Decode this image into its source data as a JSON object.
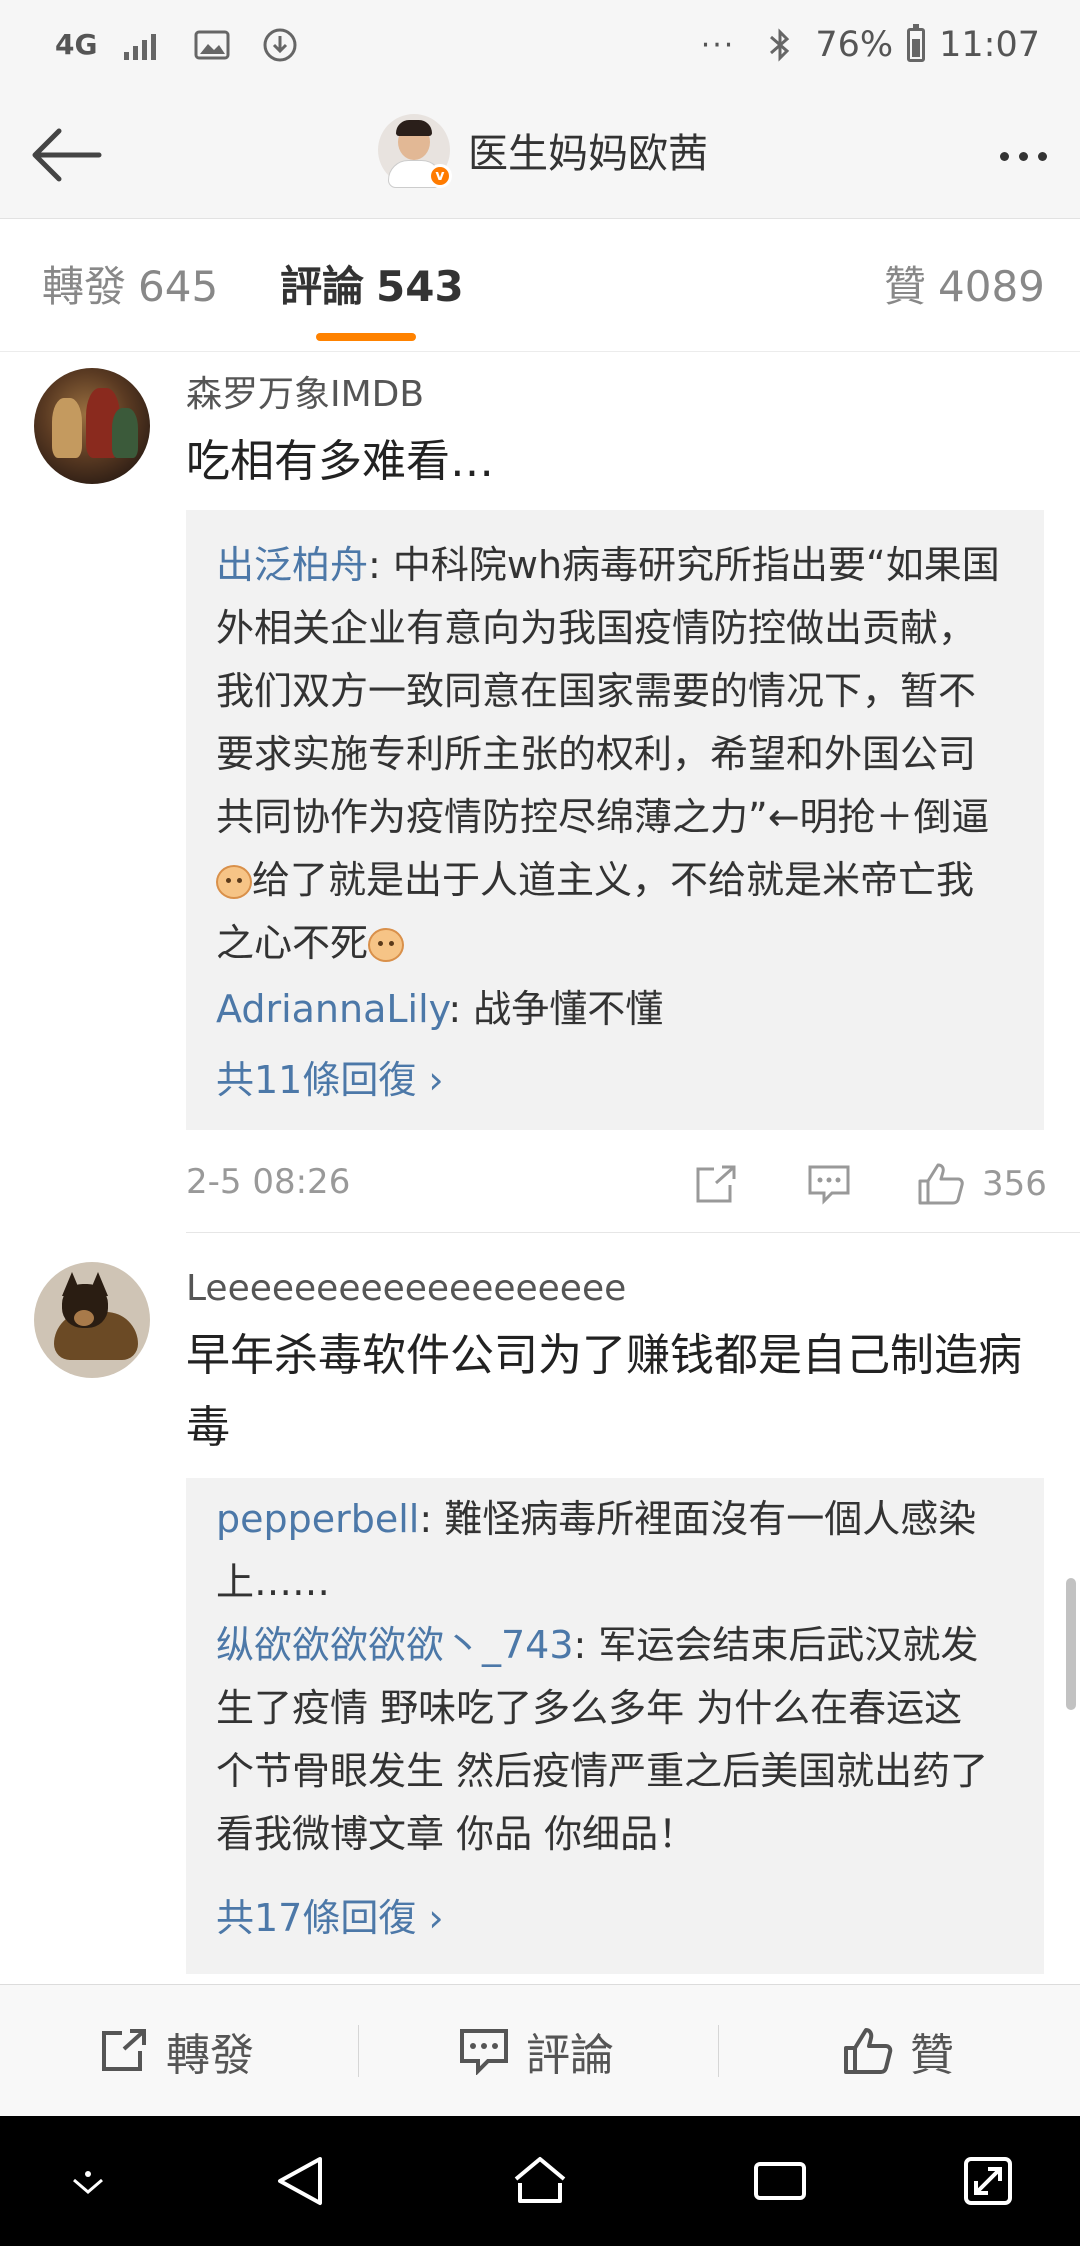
{
  "status_bar": {
    "network_label": "4G",
    "battery": "76%",
    "battery_level": 0.76,
    "time": "11:07",
    "overflow": "···"
  },
  "header": {
    "title": "医生妈妈欧茜",
    "icons": [
      "back-arrow-icon",
      "avatar",
      "more-icon"
    ]
  },
  "tabs": [
    {
      "label": "轉發",
      "count": "645"
    },
    {
      "label": "評論",
      "count": "543",
      "active": true
    },
    {
      "label": "贊",
      "count": "4089"
    }
  ],
  "comments": [
    {
      "username": "森罗万象IMDB",
      "text": "吃相有多难看…",
      "replies": [
        {
          "name": "出泛柏舟",
          "lines": [
            ": 中科院wh病毒研究所指出要“如果国",
            "外相关企业有意向为我国疫情防控做出贡献，",
            "我们双方一致同意在国家需要的情况下，暂不",
            "要求实施专利所主张的权利，希望和外国公司",
            "共同协作为疫情防控尽绵薄之力”←明抢＋倒逼",
            "给了就是出于人道主义，不给就是米帝亡我",
            "之心不死"
          ]
        },
        {
          "name": "AdriannaLily",
          "text": ": 战争懂不懂"
        }
      ],
      "more_replies": "共11條回復 ›",
      "time": "2-5 08:26",
      "likes": "356"
    },
    {
      "username": "Leeeeeeeeeeeeeeeeeee",
      "text_lines": [
        "早年杀毒软件公司为了赚钱都是自己制造病",
        "毒"
      ],
      "replies": [
        {
          "name": "pepperbell",
          "lines": [
            ": 難怪病毒所裡面沒有一個人感染",
            "上……"
          ]
        },
        {
          "name": "纵欲欲欲欲欲丶_743",
          "lines": [
            ": 军运会结束后武汉就发",
            "生了疫情 野味吃了多么多年 为什么在春运这",
            "个节骨眼发生 然后疫情严重之后美国就出药了",
            "看我微博文章 你品 你细品！"
          ]
        }
      ],
      "more_replies": "共17條回復 ›"
    }
  ],
  "action_bar": {
    "repost": "轉發",
    "comment": "評論",
    "like": "贊"
  },
  "colors": {
    "accent": "#ff8200",
    "link": "#4c78a8",
    "reply_bg": "#f2f2f2",
    "nav_bg": "#000000"
  }
}
